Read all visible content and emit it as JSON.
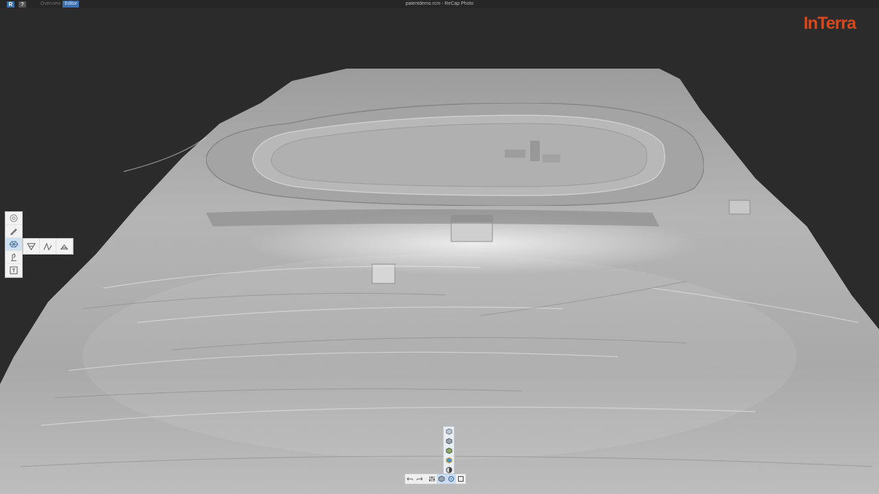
{
  "window": {
    "title": "patentdemo.rcm - ReCap Photo"
  },
  "topbar": {
    "app_icon_label": "R",
    "help_label": "?",
    "tabs": [
      {
        "label": "Overview",
        "active": false
      },
      {
        "label": "Editor",
        "active": true
      }
    ]
  },
  "brand": {
    "logo_text": "InTerra",
    "color": "#d34a21"
  },
  "left_toolbar": {
    "tools": [
      {
        "icon": "orbit-icon",
        "active": false
      },
      {
        "icon": "pencil-icon",
        "active": false
      },
      {
        "icon": "mesh-edit-icon",
        "active": true
      },
      {
        "icon": "measure-icon",
        "active": false
      },
      {
        "icon": "text-note-icon",
        "active": false
      }
    ],
    "submenu": [
      {
        "icon": "decimate-icon"
      },
      {
        "icon": "smooth-icon"
      },
      {
        "icon": "flatten-icon"
      }
    ]
  },
  "render_modes": [
    {
      "icon": "mesh-wire-icon"
    },
    {
      "icon": "mesh-shaded-icon"
    },
    {
      "icon": "mesh-textured-icon"
    },
    {
      "icon": "mesh-color-icon"
    },
    {
      "icon": "sphere-icon"
    }
  ],
  "bottom_toolbar": [
    {
      "icon": "undo-icon",
      "active": false
    },
    {
      "icon": "redo-icon",
      "active": false
    },
    {
      "icon": "settings-icon",
      "active": false
    },
    {
      "icon": "render-mode-icon",
      "active": true
    },
    {
      "icon": "navigate-icon",
      "active": true
    },
    {
      "icon": "fit-view-icon",
      "active": false
    }
  ],
  "colors": {
    "background": "#2b2b2b",
    "accent": "#3d6fb0"
  }
}
